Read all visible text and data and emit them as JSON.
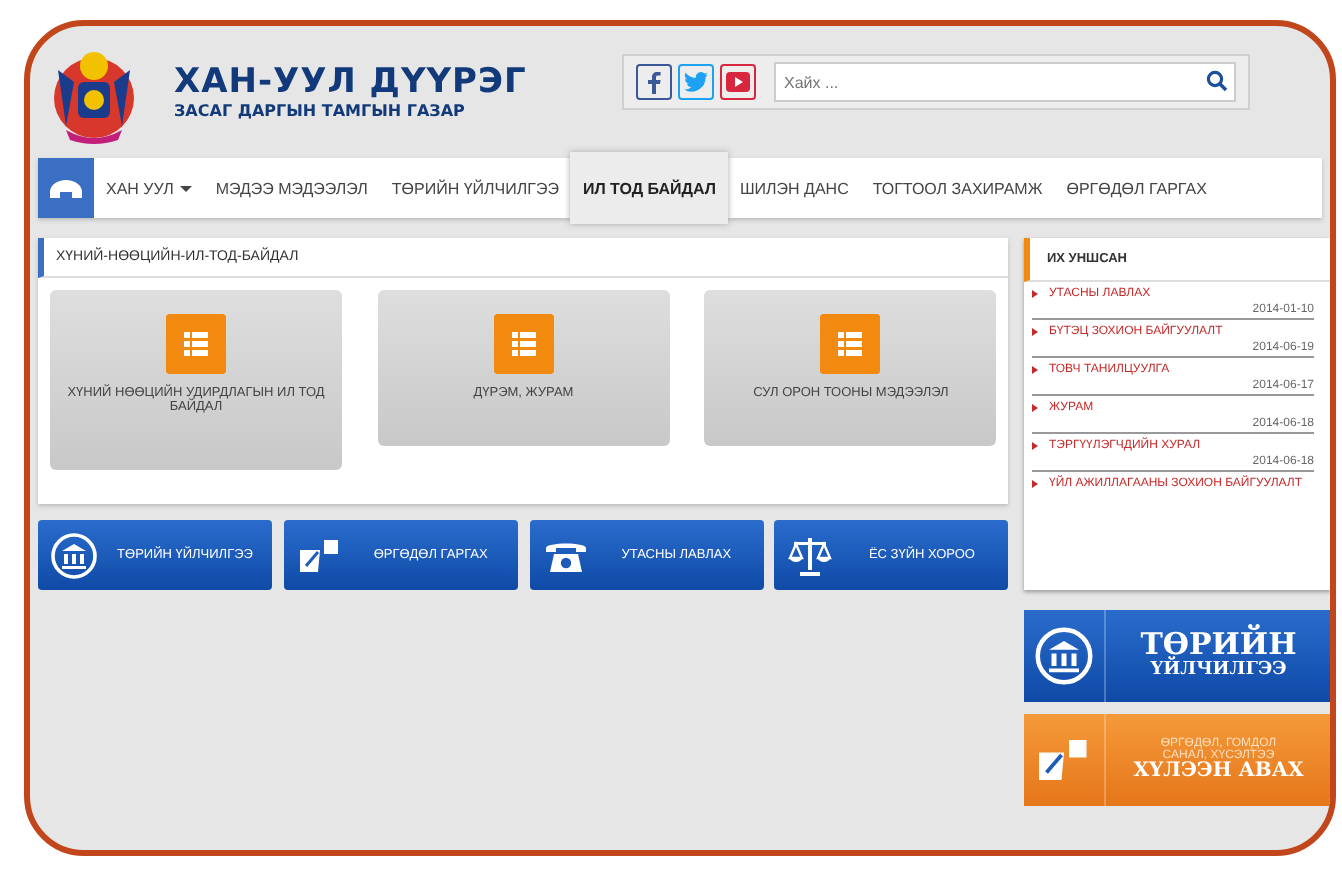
{
  "header": {
    "title": "ХАН-УУЛ ДҮҮРЭГ",
    "subtitle": "ЗАСАГ ДАРГЫН ТАМГЫН ГАЗАР",
    "search": {
      "placeholder": "Хайх ..."
    }
  },
  "nav": [
    {
      "kind": "home",
      "selected": false
    },
    {
      "kind": "dropdown",
      "label": "ХАН УУЛ",
      "selected": false
    },
    {
      "kind": "link",
      "label": "МЭДЭЭ МЭДЭЭЛЭЛ",
      "selected": false
    },
    {
      "kind": "link",
      "label": "ТӨРИЙН ҮЙЛЧИЛГЭЭ",
      "selected": false
    },
    {
      "kind": "link",
      "label": "ИЛ ТОД БАЙДАЛ",
      "selected": true
    },
    {
      "kind": "link",
      "label": "ШИЛЭН ДАНС",
      "selected": false
    },
    {
      "kind": "link",
      "label": "ТОГТООЛ ЗАХИРАМЖ",
      "selected": false
    },
    {
      "kind": "link",
      "label": "ӨРГӨДӨЛ ГАРГАХ",
      "selected": false
    }
  ],
  "panel": {
    "title": "ХҮНИЙ-НӨӨЦИЙН-ИЛ-ТОД-БАЙДАЛ",
    "tiles": [
      {
        "label": "ХҮНИЙ НӨӨЦИЙН УДИРДЛАГЫН ИЛ ТОД БАЙДАЛ"
      },
      {
        "label": "ДҮРЭМ, ЖУРАМ"
      },
      {
        "label": "СУЛ ОРОН ТООНЫ МЭДЭЭЛЭЛ"
      }
    ]
  },
  "quick_links": [
    {
      "kind": "building",
      "label": "ТӨРИЙН ҮЙЛЧИЛГЭЭ"
    },
    {
      "kind": "document",
      "label": "ӨРГӨДӨЛ ГАРГАХ"
    },
    {
      "kind": "phone",
      "label": "УТАСНЫ ЛАВЛАХ"
    },
    {
      "kind": "scales",
      "label": "ЁС ЗҮЙН ХОРОО"
    }
  ],
  "popular": {
    "title": "ИХ УНШСАН",
    "items": [
      {
        "title": "УТАСНЫ ЛАВЛАХ",
        "date": "2014-01-10"
      },
      {
        "title": "БҮТЭЦ ЗОХИОН БАЙГУУЛАЛТ",
        "date": "2014-06-19"
      },
      {
        "title": "ТОВЧ ТАНИЛЦУУЛГА",
        "date": "2014-06-17"
      },
      {
        "title": "ЖУРАМ",
        "date": "2014-06-18"
      },
      {
        "title": "ТЭРГҮҮЛЭГЧДИЙН ХУРАЛ",
        "date": "2014-06-18"
      },
      {
        "title": "ҮЙЛ АЖИЛЛАГААНЫ ЗОХИОН БАЙГУУЛАЛТ"
      }
    ]
  },
  "banners": [
    {
      "kind": "building",
      "lines": [
        "ТӨРИЙН",
        "ҮЙЛЧИЛГЭЭ"
      ]
    },
    {
      "kind": "document",
      "lines": [
        "ӨРГӨДӨЛ, ГОМДОЛ",
        "САНАЛ, ХҮСЭЛТЭЭ",
        "ХҮЛЭЭН АВАХ"
      ]
    }
  ]
}
